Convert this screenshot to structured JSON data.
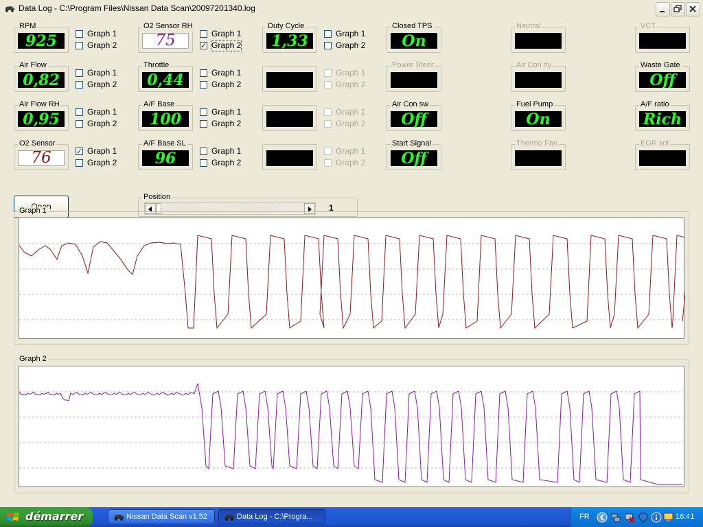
{
  "window": {
    "title": "Data Log - C:\\Program Files\\Nissan Data Scan\\20097201340.log"
  },
  "colors": {
    "digit_green": "#22ff22",
    "graph1_line": "#8b1a1a",
    "graph2_line": "#8b1aa0",
    "o2_value": "#8b1a1a",
    "o2rh_value": "#8b1aa0"
  },
  "gauges": {
    "rpm": {
      "label": "RPM",
      "value": "925"
    },
    "o2_sensor_rh": {
      "label": "O2 Sensor RH",
      "value": "75"
    },
    "duty_cycle": {
      "label": "Duty Cycle",
      "value": "1,33"
    },
    "air_flow": {
      "label": "Air Flow",
      "value": "0,82"
    },
    "throttle": {
      "label": "Throttle",
      "value": "0,44"
    },
    "air_flow_rh": {
      "label": "Air Flow RH",
      "value": "0,95"
    },
    "af_base": {
      "label": "A/F Base",
      "value": "100"
    },
    "o2_sensor": {
      "label": "O2 Sensor",
      "value": "76"
    },
    "af_base_sl": {
      "label": "A/F Base SL",
      "value": "96"
    }
  },
  "status": {
    "closed_tps": {
      "label": "Closed TPS",
      "value": "On"
    },
    "neutral": {
      "label": "Neutral",
      "value": ""
    },
    "vct": {
      "label": "VCT",
      "value": ""
    },
    "power_steer": {
      "label": "Power Steer",
      "value": ""
    },
    "air_con_rly": {
      "label": "Air Con rly",
      "value": ""
    },
    "waste_gate": {
      "label": "Waste Gate",
      "value": "Off"
    },
    "air_con_sw": {
      "label": "Air Con sw",
      "value": "Off"
    },
    "fuel_pump": {
      "label": "Fuel Pump",
      "value": "On"
    },
    "af_ratio": {
      "label": "A/F ratio",
      "value": "Rich"
    },
    "start_signal": {
      "label": "Start Signal",
      "value": "Off"
    },
    "thermo_fan": {
      "label": "Thermo Fan",
      "value": ""
    },
    "egr_sol": {
      "label": "EGR sol",
      "value": ""
    }
  },
  "checkbox": {
    "graph1": "Graph 1",
    "graph2": "Graph 2"
  },
  "buttons": {
    "open": "Open"
  },
  "position": {
    "label": "Position",
    "value": "1"
  },
  "graphs": {
    "graph1_label": "Graph 1",
    "graph2_label": "Graph 2"
  },
  "taskbar": {
    "start": "démarrer",
    "tasks": [
      "Nissan Data Scan v1.52",
      "Data Log - C:\\Progra..."
    ],
    "lang": "FR",
    "clock": "16:41"
  }
}
